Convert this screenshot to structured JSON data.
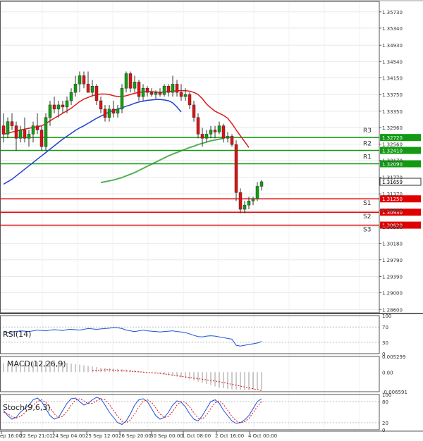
{
  "chart_data": [
    {
      "type": "candlestick",
      "panel": "price",
      "ylim": [
        1.2852,
        1.3598
      ],
      "y_ticks": [
        "1.35730",
        "1.35340",
        "1.34930",
        "1.34540",
        "1.34150",
        "1.33750",
        "1.33350",
        "1.32960",
        "1.32560",
        "1.32170",
        "1.31770",
        "1.31370",
        "1.30980",
        "1.30580",
        "1.30180",
        "1.29790",
        "1.29390",
        "1.29000",
        "1.28600"
      ],
      "grid": true,
      "candles": [
        {
          "o": 1.33,
          "h": 1.333,
          "l": 1.326,
          "c": 1.328
        },
        {
          "o": 1.328,
          "h": 1.332,
          "l": 1.327,
          "c": 1.331
        },
        {
          "o": 1.331,
          "h": 1.333,
          "l": 1.329,
          "c": 1.33
        },
        {
          "o": 1.33,
          "h": 1.331,
          "l": 1.324,
          "c": 1.327
        },
        {
          "o": 1.327,
          "h": 1.33,
          "l": 1.326,
          "c": 1.329
        },
        {
          "o": 1.329,
          "h": 1.332,
          "l": 1.326,
          "c": 1.327
        },
        {
          "o": 1.327,
          "h": 1.329,
          "l": 1.325,
          "c": 1.328
        },
        {
          "o": 1.328,
          "h": 1.331,
          "l": 1.326,
          "c": 1.33
        },
        {
          "o": 1.33,
          "h": 1.333,
          "l": 1.328,
          "c": 1.329
        },
        {
          "o": 1.329,
          "h": 1.33,
          "l": 1.324,
          "c": 1.325
        },
        {
          "o": 1.325,
          "h": 1.333,
          "l": 1.324,
          "c": 1.332
        },
        {
          "o": 1.332,
          "h": 1.336,
          "l": 1.33,
          "c": 1.335
        },
        {
          "o": 1.335,
          "h": 1.337,
          "l": 1.333,
          "c": 1.334
        },
        {
          "o": 1.334,
          "h": 1.336,
          "l": 1.332,
          "c": 1.335
        },
        {
          "o": 1.335,
          "h": 1.336,
          "l": 1.333,
          "c": 1.3345
        },
        {
          "o": 1.3345,
          "h": 1.337,
          "l": 1.333,
          "c": 1.336
        },
        {
          "o": 1.336,
          "h": 1.339,
          "l": 1.335,
          "c": 1.338
        },
        {
          "o": 1.338,
          "h": 1.342,
          "l": 1.337,
          "c": 1.34
        },
        {
          "o": 1.34,
          "h": 1.343,
          "l": 1.338,
          "c": 1.342
        },
        {
          "o": 1.342,
          "h": 1.343,
          "l": 1.339,
          "c": 1.34
        },
        {
          "o": 1.34,
          "h": 1.343,
          "l": 1.338,
          "c": 1.338
        },
        {
          "o": 1.338,
          "h": 1.341,
          "l": 1.337,
          "c": 1.3395
        },
        {
          "o": 1.3395,
          "h": 1.34,
          "l": 1.335,
          "c": 1.336
        },
        {
          "o": 1.336,
          "h": 1.337,
          "l": 1.333,
          "c": 1.334
        },
        {
          "o": 1.334,
          "h": 1.335,
          "l": 1.331,
          "c": 1.332
        },
        {
          "o": 1.332,
          "h": 1.335,
          "l": 1.331,
          "c": 1.334
        },
        {
          "o": 1.334,
          "h": 1.336,
          "l": 1.332,
          "c": 1.333
        },
        {
          "o": 1.333,
          "h": 1.335,
          "l": 1.332,
          "c": 1.334
        },
        {
          "o": 1.334,
          "h": 1.34,
          "l": 1.333,
          "c": 1.339
        },
        {
          "o": 1.339,
          "h": 1.343,
          "l": 1.338,
          "c": 1.3425
        },
        {
          "o": 1.3425,
          "h": 1.343,
          "l": 1.338,
          "c": 1.339
        },
        {
          "o": 1.339,
          "h": 1.342,
          "l": 1.338,
          "c": 1.3405
        },
        {
          "o": 1.3405,
          "h": 1.341,
          "l": 1.336,
          "c": 1.337
        },
        {
          "o": 1.337,
          "h": 1.34,
          "l": 1.336,
          "c": 1.339
        },
        {
          "o": 1.339,
          "h": 1.3395,
          "l": 1.337,
          "c": 1.338
        },
        {
          "o": 1.338,
          "h": 1.339,
          "l": 1.337,
          "c": 1.3375
        },
        {
          "o": 1.3375,
          "h": 1.3385,
          "l": 1.3365,
          "c": 1.338
        },
        {
          "o": 1.338,
          "h": 1.339,
          "l": 1.337,
          "c": 1.3375
        },
        {
          "o": 1.3375,
          "h": 1.34,
          "l": 1.337,
          "c": 1.3395
        },
        {
          "o": 1.3395,
          "h": 1.34,
          "l": 1.337,
          "c": 1.338
        },
        {
          "o": 1.338,
          "h": 1.342,
          "l": 1.337,
          "c": 1.34
        },
        {
          "o": 1.34,
          "h": 1.341,
          "l": 1.337,
          "c": 1.338
        },
        {
          "o": 1.338,
          "h": 1.34,
          "l": 1.336,
          "c": 1.337
        },
        {
          "o": 1.337,
          "h": 1.339,
          "l": 1.336,
          "c": 1.3375
        },
        {
          "o": 1.3375,
          "h": 1.338,
          "l": 1.334,
          "c": 1.335
        },
        {
          "o": 1.335,
          "h": 1.336,
          "l": 1.331,
          "c": 1.332
        },
        {
          "o": 1.332,
          "h": 1.333,
          "l": 1.327,
          "c": 1.328
        },
        {
          "o": 1.328,
          "h": 1.3295,
          "l": 1.325,
          "c": 1.327
        },
        {
          "o": 1.327,
          "h": 1.329,
          "l": 1.326,
          "c": 1.328
        },
        {
          "o": 1.328,
          "h": 1.33,
          "l": 1.327,
          "c": 1.329
        },
        {
          "o": 1.329,
          "h": 1.33,
          "l": 1.327,
          "c": 1.3285
        },
        {
          "o": 1.3285,
          "h": 1.331,
          "l": 1.328,
          "c": 1.33
        },
        {
          "o": 1.33,
          "h": 1.3305,
          "l": 1.326,
          "c": 1.327
        },
        {
          "o": 1.327,
          "h": 1.3285,
          "l": 1.326,
          "c": 1.3275
        },
        {
          "o": 1.3275,
          "h": 1.328,
          "l": 1.325,
          "c": 1.3255
        },
        {
          "o": 1.3255,
          "h": 1.3265,
          "l": 1.312,
          "c": 1.314
        },
        {
          "o": 1.314,
          "h": 1.315,
          "l": 1.309,
          "c": 1.31
        },
        {
          "o": 1.31,
          "h": 1.312,
          "l": 1.309,
          "c": 1.311
        },
        {
          "o": 1.311,
          "h": 1.313,
          "l": 1.31,
          "c": 1.312
        },
        {
          "o": 1.312,
          "h": 1.313,
          "l": 1.311,
          "c": 1.3125
        },
        {
          "o": 1.3125,
          "h": 1.3165,
          "l": 1.312,
          "c": 1.3155
        },
        {
          "o": 1.3155,
          "h": 1.317,
          "l": 1.3145,
          "c": 1.3166
        }
      ],
      "ma_red": [
        1.328,
        1.3282,
        1.3285,
        1.3287,
        1.329,
        1.3292,
        1.3294,
        1.3296,
        1.3298,
        1.33,
        1.3305,
        1.3312,
        1.3318,
        1.3324,
        1.333,
        1.3336,
        1.3342,
        1.335,
        1.3358,
        1.3364,
        1.3368,
        1.3372,
        1.3375,
        1.3376,
        1.3376,
        1.3375,
        1.3372,
        1.337,
        1.337,
        1.3372,
        1.3375,
        1.3378,
        1.338,
        1.3381,
        1.3382,
        1.3382,
        1.3381,
        1.338,
        1.3381,
        1.3382,
        1.3383,
        1.3384,
        1.3384,
        1.3384,
        1.3383,
        1.338,
        1.3375,
        1.3365,
        1.3352,
        1.3343,
        1.3335,
        1.333,
        1.3325,
        1.3318,
        1.3305,
        1.329,
        1.3276,
        1.3262,
        1.3248
      ],
      "ma_blue": [
        1.316,
        1.3166,
        1.3172,
        1.318,
        1.3188,
        1.3196,
        1.3204,
        1.3212,
        1.322,
        1.3228,
        1.3236,
        1.3244,
        1.3252,
        1.326,
        1.3268,
        1.3275,
        1.3282,
        1.3289,
        1.3295,
        1.33,
        1.3306,
        1.3312,
        1.3318,
        1.3323,
        1.3328,
        1.3333,
        1.3337,
        1.334,
        1.3343,
        1.3347,
        1.335,
        1.3354,
        1.3357,
        1.3359,
        1.3361,
        1.3362,
        1.3363,
        1.3363,
        1.3362,
        1.336,
        1.3355,
        1.3345,
        1.3333
      ],
      "ma_green": [
        1.3164,
        1.3166,
        1.3168,
        1.317,
        1.3173,
        1.3176,
        1.318,
        1.3184,
        1.3188,
        1.3193,
        1.3198,
        1.3203,
        1.3208,
        1.3213,
        1.3218,
        1.3223,
        1.3228,
        1.3232,
        1.3236,
        1.324,
        1.3244,
        1.3248,
        1.3251,
        1.3255,
        1.3258,
        1.3261,
        1.3264,
        1.3266,
        1.3268,
        1.327
      ],
      "levels": [
        {
          "label": "R3",
          "price": 1.3272,
          "price_text": "1.32720",
          "color": "#139a13"
        },
        {
          "label": "R2",
          "price": 1.3241,
          "price_text": "1.32410",
          "color": "#139a13"
        },
        {
          "label": "R1",
          "price": 1.3209,
          "price_text": "1.32090",
          "color": "#139a13"
        },
        {
          "label": "S1",
          "price": 1.3125,
          "price_text": "1.31250",
          "color": "#e00000"
        },
        {
          "label": "S2",
          "price": 1.3093,
          "price_text": "1.30930",
          "color": "#e00000"
        },
        {
          "label": "S3",
          "price": 1.3062,
          "price_text": "1.30620",
          "color": "#e00000"
        }
      ],
      "current_price": {
        "price": 1.31659,
        "text": "1.31659"
      }
    },
    {
      "type": "line",
      "panel": "rsi",
      "title": "RSI(14)",
      "ylim": [
        0,
        100
      ],
      "y_ticks": [
        "100",
        "70",
        "30",
        "0"
      ],
      "values": [
        55,
        56,
        57,
        58,
        60,
        59,
        58,
        60,
        62,
        61,
        60,
        62,
        63,
        62,
        61,
        63,
        64,
        63,
        62,
        64,
        66,
        65,
        64,
        65,
        66,
        67,
        69,
        68,
        66,
        62,
        60,
        58,
        60,
        62,
        60,
        59,
        58,
        57,
        58,
        59,
        60,
        58,
        57,
        55,
        52,
        48,
        45,
        44,
        46,
        47,
        46,
        44,
        42,
        40,
        38,
        22,
        20,
        22,
        24,
        26,
        28,
        32
      ]
    },
    {
      "type": "bar",
      "panel": "macd",
      "title": "MACD(12,26,9)",
      "ylim": [
        -0.006591,
        0.005299
      ],
      "y_ticks": [
        "0.005299",
        "0.00",
        "-0.006591"
      ],
      "values": [
        0.003,
        0.003,
        0.0029,
        0.003,
        0.0031,
        0.0032,
        0.0033,
        0.0034,
        0.0035,
        0.0035,
        0.0036,
        0.0036,
        0.0035,
        0.0034,
        0.0033,
        0.0031,
        0.0029,
        0.0027,
        0.0025,
        0.0023,
        0.0021,
        0.0019,
        0.0017,
        0.0015,
        0.0014,
        0.0013,
        0.0012,
        0.0011,
        0.001,
        0.0009,
        0.0008,
        0.0006,
        0.0004,
        0.0002,
        0.0,
        -0.0002,
        -0.0004,
        -0.0006,
        -0.0008,
        -0.001,
        -0.0012,
        -0.0015,
        -0.0018,
        -0.0021,
        -0.0024,
        -0.0028,
        -0.0032,
        -0.0036,
        -0.004,
        -0.0044,
        -0.0048,
        -0.0052,
        -0.0054,
        -0.0056,
        -0.0058,
        -0.0059,
        -0.006,
        -0.0061,
        -0.0061,
        -0.006,
        -0.0059,
        -0.0058
      ],
      "signal": [
        0.0005,
        0.0006,
        0.0007,
        0.0008,
        0.0008,
        0.0007,
        0.0006,
        0.0005,
        0.0004,
        0.0003,
        0.0002,
        0.0001,
        0.0,
        -0.0001,
        -0.0002,
        -0.0003,
        -0.0004,
        -0.0006,
        -0.0008,
        -0.001,
        -0.0012,
        -0.0014,
        -0.0016,
        -0.0018,
        -0.002,
        -0.0022,
        -0.0024,
        -0.0026,
        -0.0028,
        -0.003,
        -0.0032,
        -0.0035,
        -0.0038,
        -0.0041,
        -0.0044,
        -0.0047,
        -0.005,
        -0.0053,
        -0.0056,
        -0.0059,
        -0.0062
      ]
    },
    {
      "type": "line",
      "panel": "stoch",
      "title": "Stoch(9,6,3)",
      "ylim": [
        0,
        100
      ],
      "y_ticks": [
        "100",
        "80",
        "20",
        "0"
      ],
      "k": [
        55,
        40,
        30,
        35,
        50,
        60,
        70,
        85,
        90,
        80,
        60,
        40,
        30,
        35,
        55,
        75,
        88,
        90,
        80,
        70,
        75,
        85,
        92,
        88,
        70,
        50,
        35,
        20,
        15,
        25,
        45,
        70,
        85,
        88,
        80,
        60,
        40,
        30,
        35,
        50,
        70,
        82,
        78,
        65,
        45,
        30,
        25,
        40,
        60,
        80,
        85,
        75,
        55,
        40,
        25,
        18,
        20,
        28,
        40,
        60,
        80,
        88
      ],
      "d": [
        50,
        45,
        38,
        33,
        38,
        48,
        58,
        70,
        80,
        85,
        78,
        62,
        45,
        35,
        38,
        52,
        70,
        84,
        88,
        82,
        74,
        75,
        82,
        88,
        85,
        72,
        55,
        38,
        24,
        20,
        28,
        45,
        65,
        80,
        85,
        78,
        62,
        45,
        35,
        38,
        52,
        70,
        80,
        78,
        65,
        48,
        33,
        30,
        42,
        60,
        76,
        82,
        72,
        55,
        38,
        25,
        20,
        23,
        32,
        48,
        66,
        80
      ]
    },
    {
      "type": "axis",
      "x_ticks": [
        "ep 16:00",
        "22 Sep 21:01",
        "24 Sep 04:00",
        "25 Sep 12:00",
        "26 Sep 20:00",
        "30 Sep 00:00",
        "1 Oct 08:00",
        "2 Oct 16:00",
        "4 Oct 00:00"
      ]
    }
  ]
}
